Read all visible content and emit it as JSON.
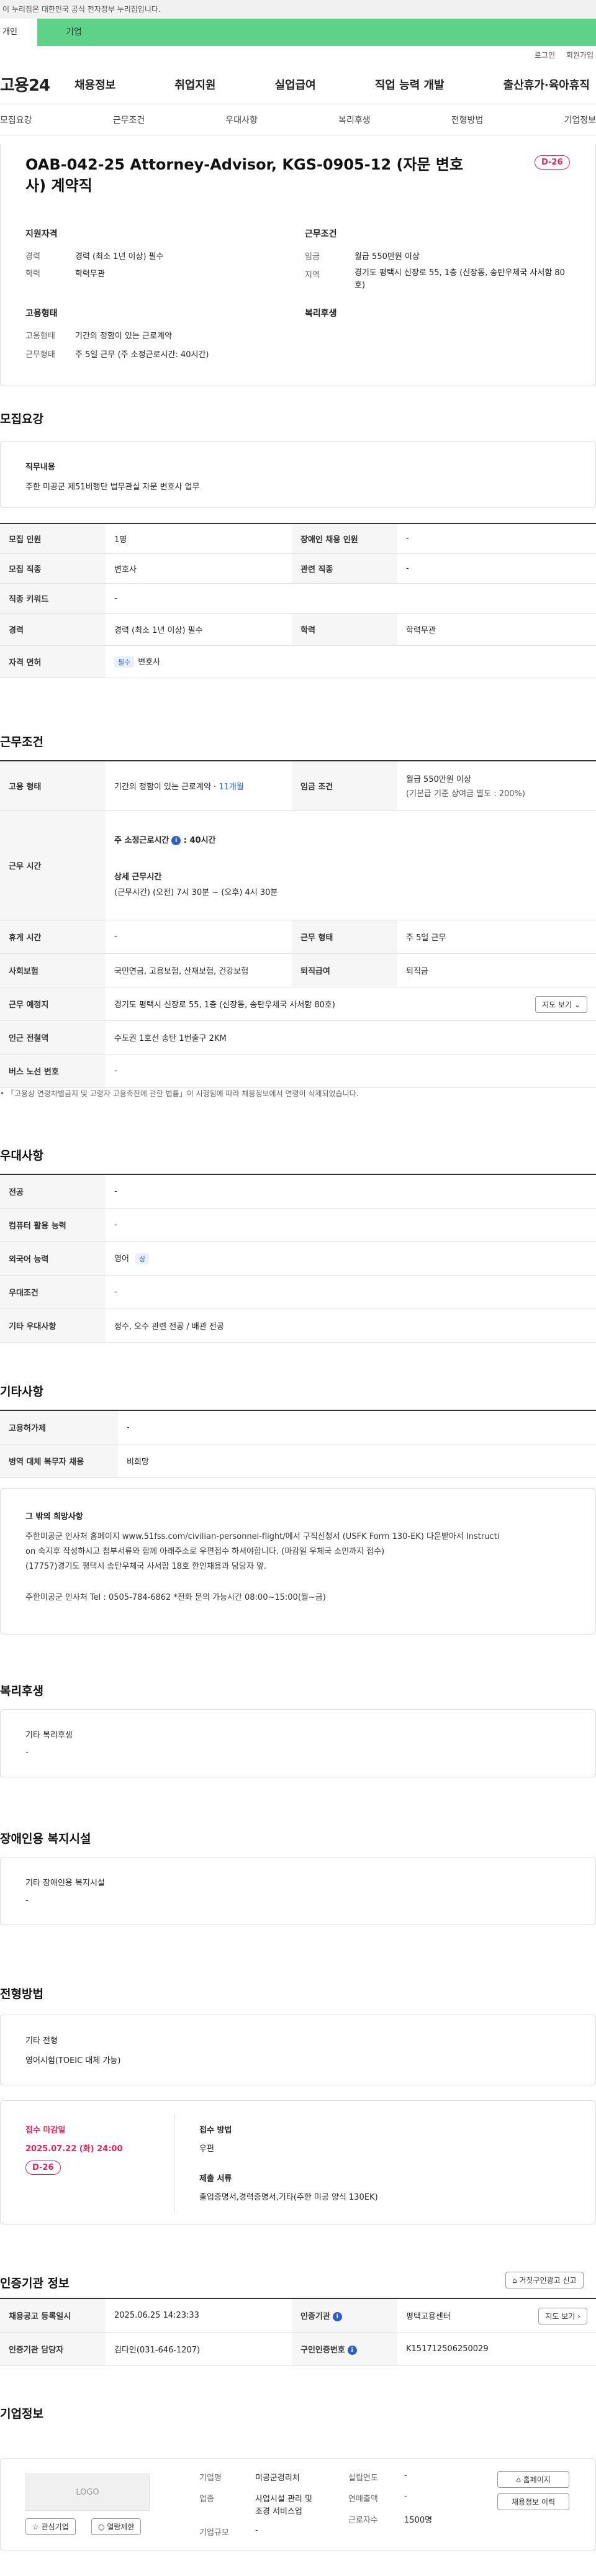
{
  "gov_banner": "이 누리집은 대한민국 공식 전자정부 누리집입니다.",
  "top_tabs": {
    "person": "개인",
    "company": "기업"
  },
  "util": {
    "login": "로그인",
    "join": "회원가입"
  },
  "logo": "고용24",
  "gnb": [
    "채용정보",
    "취업지원",
    "실업급여",
    "직업 능력 개발",
    "출산휴가·육아휴직"
  ],
  "subnav": [
    "모집요강",
    "근무조건",
    "우대사항",
    "복리후생",
    "전형방법",
    "기업정보"
  ],
  "job": {
    "title": "OAB-042-25 Attorney-Advisor, KGS-0905-12 (자문 변호사) 계약직",
    "dday": "D-26",
    "qual_title": "지원자격",
    "career_label": "경력",
    "career_value": "경력 (최소 1년 이상) 필수",
    "edu_label": "학력",
    "edu_value": "학력무관",
    "emp_title": "고용형태",
    "emp_type_label": "고용형태",
    "emp_type_value": "기간의 정함이 있는 근로계약",
    "work_time_label": "근무형태",
    "work_time_value": "주 5일 근무 (주 소정근로시간: 40시간)",
    "cond_title": "근무조건",
    "wage_label": "임금",
    "wage_value": "월급 550만원 이상",
    "region_label": "지역",
    "region_value": "경기도 평택시 신장로 55, 1층 (신장동, 송탄우체국 사서함 80호)",
    "welfare_title": "복리후생"
  },
  "recruit": {
    "heading": "모집요강",
    "duty_label": "직무내용",
    "duty_value": "주한 미공군 제51비행단 법무관실 자문 변호사 업무",
    "rows": [
      {
        "k1": "모집 인원",
        "v1": "1명",
        "k2": "장애인 채용 인원",
        "v2": "-"
      },
      {
        "k1": "모집 직종",
        "v1": "변호사",
        "k2": "관련 직종",
        "v2": "-"
      },
      {
        "k1": "직종 키워드",
        "v1": "-"
      },
      {
        "k1": "경력",
        "v1": "경력 (최소 1년 이상) 필수",
        "k2": "학력",
        "v2": "학력무관"
      }
    ],
    "license_label": "자격 면허",
    "license_badge": "필수",
    "license_value": "변호사"
  },
  "conditions": {
    "heading": "근무조건",
    "emp_label": "고용 형태",
    "emp_value": "기간의 정함이 있는 근로계약 · ",
    "emp_months": "11개월",
    "wage_label": "임금 조건",
    "wage_line1": "월급 550만원 이상",
    "wage_line2": "(기본급 기준 상여금 별도 : 200%)",
    "hours_label": "근무 시간",
    "hours_weekly": "주 소정근로시간",
    "hours_weekly_value": ": 40시간",
    "hours_detail_title": "상세 근무시간",
    "hours_detail": "(근무시간) (오전) 7시 30분 ~ (오후) 4시 30분",
    "break_label": "휴게 시간",
    "break_value": "-",
    "shift_label": "근무 형태",
    "shift_value": "주 5일 근무",
    "insurance_label": "사회보험",
    "insurance_value": "국민연금, 고용보험, 산재보험, 건강보험",
    "severance_label": "퇴직급여",
    "severance_value": "퇴직금",
    "place_label": "근무 예정지",
    "place_value": "경기도 평택시 신장로 55, 1층 (신장동, 송탄우체국 사서함 80호)",
    "map_btn": "지도 보기",
    "station_label": "인근 전철역",
    "station_value": "수도권 1호선 송탄 1번출구 2KM",
    "bus_label": "버스 노선 번호",
    "bus_value": "-",
    "notice": "「고용상 연령차별금지 및 고령자 고용촉진에 관한 법률」이 시행됨에 따라 채용정보에서 연령이 삭제되었습니다."
  },
  "preference": {
    "heading": "우대사항",
    "rows": [
      {
        "k": "전공",
        "v": "-"
      },
      {
        "k": "컴퓨터 활용 능력",
        "v": "-"
      },
      {
        "k": "외국어 능력",
        "v": "영어",
        "badge": "상"
      },
      {
        "k": "우대조건",
        "v": "-"
      },
      {
        "k": "기타 우대사항",
        "v": "정수, 오수 관련 전공 / 배관 전공"
      }
    ]
  },
  "etc": {
    "heading": "기타사항",
    "rows": [
      {
        "k": "고용허가제",
        "v": "-"
      },
      {
        "k": "병역 대체 복무자 채용",
        "v": "비희망"
      }
    ],
    "box_title": "그 밖의 희망사항",
    "box_line1": "주한미공군 인사처 홈페이지 www.51fss.com/civilian-personnel-flight/에서 구직신청서 (USFK Form 130-EK) 다운받아서 Instructi",
    "box_line2": "on 숙지후 작성하시고 첨부서류와 함께 아래주소로 우편접수 하셔야합니다. (마감일 우체국 소인까지 접수)",
    "box_line3": "(17757)경기도 평택시 송탄우체국 사서함 18호 한인채용과 담당자 앞.",
    "box_line4": "주한미공군 인사처 Tel : 0505-784-6862 *전화 문의 가능시간 08:00~15:00(월~금)"
  },
  "welfare": {
    "heading": "복리후생",
    "label": "기타 복리후생",
    "value": "-"
  },
  "disabled": {
    "heading": "장애인용 복지시설",
    "label": "기타 장애인용 복지시설",
    "value": "-"
  },
  "selection": {
    "heading": "전형방법",
    "label": "기타 전형",
    "value": "영어시험(TOEIC 대체 가능)",
    "deadline_label": "접수 마감일",
    "deadline_value": "2025.07.22 (화) 24:00",
    "deadline_dday": "D-26",
    "method_label": "접수 방법",
    "method_value": "우편",
    "docs_label": "제출 서류",
    "docs_value": "졸업증명서,경력증명서,기타(주한 미공 양식 130EK)"
  },
  "cert": {
    "heading": "인증기관 정보",
    "report_btn": "거짓구인광고 신고",
    "reg_label": "채용공고 등록일시",
    "reg_value": "2025.06.25 14:23:33",
    "agency_label": "인증기관",
    "agency_value": "평택고용센터",
    "map_btn": "지도 보기",
    "manager_label": "인증기관 담당자",
    "manager_value": "김다인(031-646-1207)",
    "num_label": "구인인증번호",
    "num_value": "K151712506250029"
  },
  "company": {
    "heading": "기업정보",
    "logo_text": "LOGO",
    "fav_btn": "관심기업",
    "interview_btn": "열람제한",
    "name_label": "기업명",
    "name_value": "미공군경리처",
    "industry_label": "업종",
    "industry_value1": "사업시설 관리 및",
    "industry_value2": "조경 서비스업",
    "size_label": "기업규모",
    "size_value": "-",
    "est_label": "설립연도",
    "est_value": "-",
    "sales_label": "연매출액",
    "sales_value": "-",
    "emp_label": "근로자수",
    "emp_value": "1500명",
    "home_btn": "홈페이지",
    "list_btn": "채용정보 이력"
  }
}
